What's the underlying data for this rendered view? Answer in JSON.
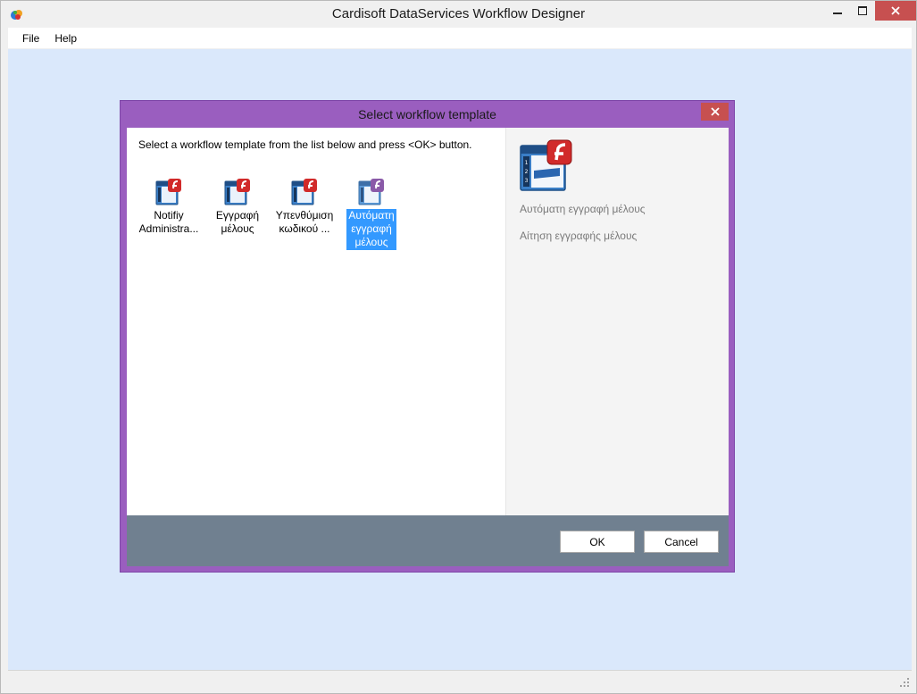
{
  "window": {
    "title": "Cardisoft DataServices Workflow Designer"
  },
  "menu": {
    "file": "File",
    "help": "Help"
  },
  "dialog": {
    "title": "Select workflow template",
    "instructions": "Select a workflow template from the list below and press <OK> button.",
    "templates": [
      {
        "label_line1": "Notifiy",
        "label_line2": "Administra...",
        "label_line3": "",
        "selected": false
      },
      {
        "label_line1": "Εγγραφή",
        "label_line2": "μέλους",
        "label_line3": "",
        "selected": false
      },
      {
        "label_line1": "Υπενθύμιση",
        "label_line2": "κωδικού ...",
        "label_line3": "",
        "selected": false
      },
      {
        "label_line1": "Αυτόματη",
        "label_line2": "εγγραφή",
        "label_line3": "μέλους",
        "selected": true
      }
    ],
    "detail": {
      "name": "Αυτόματη εγγραφή μέλους",
      "description": "Αίτηση εγγραφής μέλους"
    },
    "ok_label": "OK",
    "cancel_label": "Cancel"
  },
  "colors": {
    "dialog_frame": "#9a5ebf",
    "button_bar": "#708090",
    "mdi_background": "#dae8fb",
    "selection": "#3399ff",
    "close_button": "#c75050"
  },
  "icons": {
    "app": "cardisoft-app-icon",
    "template": "flash-geturl-icon"
  }
}
